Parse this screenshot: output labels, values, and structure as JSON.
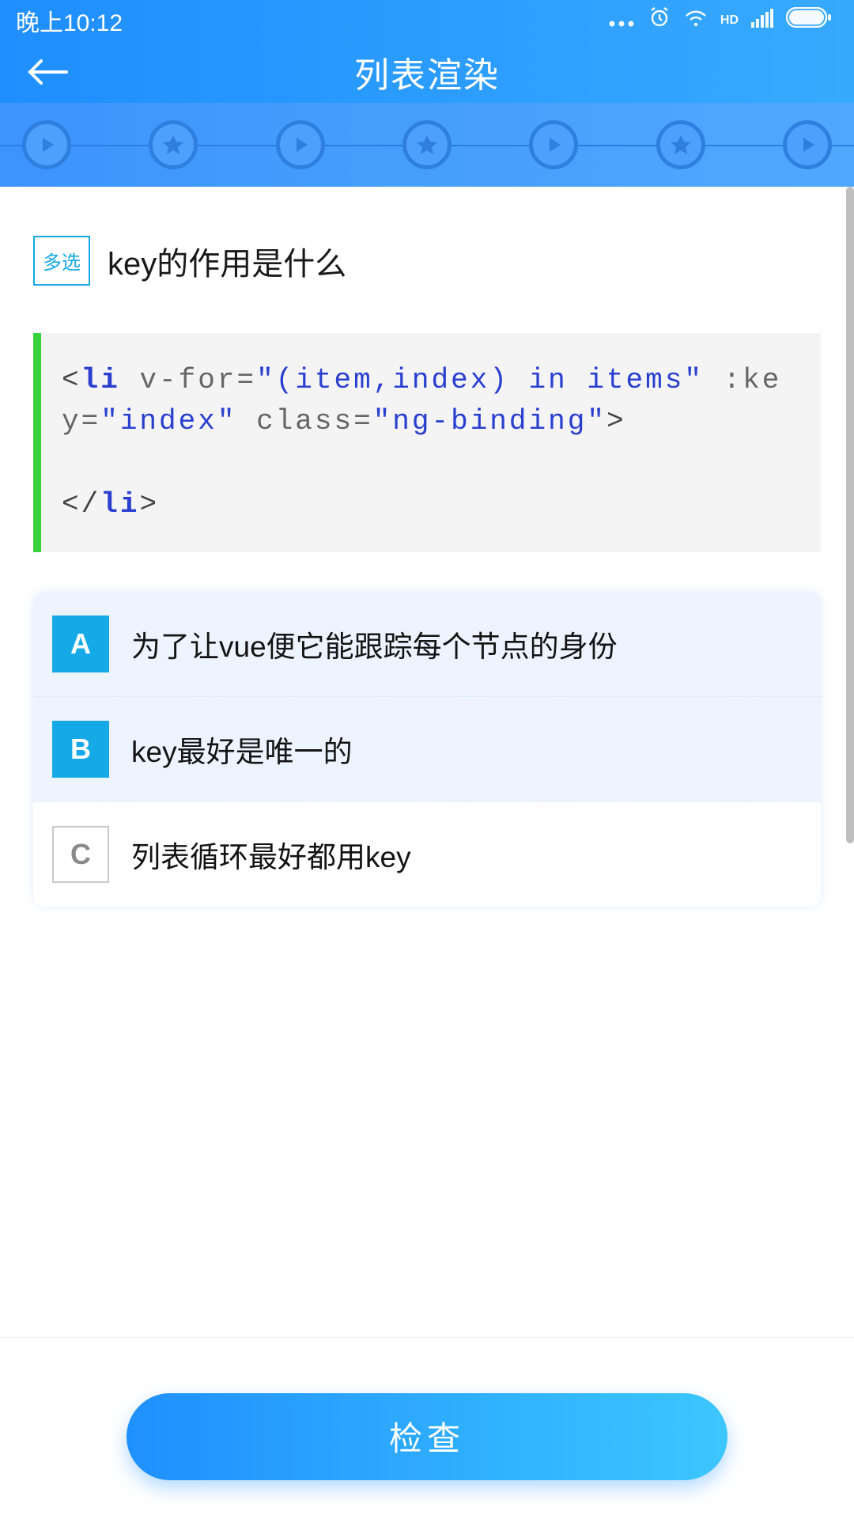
{
  "status": {
    "time": "晚上10:12",
    "hd_label": "HD"
  },
  "header": {
    "title": "列表渲染"
  },
  "progress": {
    "steps": [
      "play",
      "star",
      "play",
      "star",
      "play",
      "star",
      "play"
    ]
  },
  "question": {
    "tag": "多选",
    "title": "key的作用是什么",
    "code_tokens": [
      {
        "t": "<",
        "c": "plain"
      },
      {
        "t": "li",
        "c": "tag"
      },
      {
        "t": " ",
        "c": "plain"
      },
      {
        "t": "v-for=",
        "c": "attr"
      },
      {
        "t": "\"(item,index) in items\"",
        "c": "str"
      },
      {
        "t": " ",
        "c": "plain"
      },
      {
        "t": ":key=",
        "c": "attr"
      },
      {
        "t": "\"index\"",
        "c": "str"
      },
      {
        "t": " ",
        "c": "plain"
      },
      {
        "t": "class=",
        "c": "attr"
      },
      {
        "t": "\"ng-binding\"",
        "c": "str"
      },
      {
        "t": ">",
        "c": "plain"
      },
      {
        "t": "\n\n",
        "c": "plain"
      },
      {
        "t": "</",
        "c": "plain"
      },
      {
        "t": "li",
        "c": "tag"
      },
      {
        "t": ">",
        "c": "plain"
      }
    ],
    "choices": [
      {
        "letter": "A",
        "text": "为了让vue便它能跟踪每个节点的身份",
        "selected": true
      },
      {
        "letter": "B",
        "text": "key最好是唯一的",
        "selected": true
      },
      {
        "letter": "C",
        "text": "列表循环最好都用key",
        "selected": false
      }
    ]
  },
  "actions": {
    "check": "检查"
  }
}
